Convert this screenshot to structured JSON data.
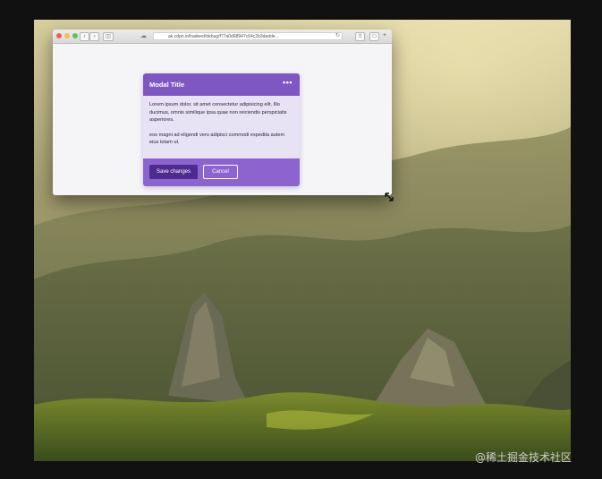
{
  "browser": {
    "address_text": "ak.cdpn.io/hadeed/debug/f77a0d68947c64c2b3dadde..."
  },
  "modal": {
    "title": "Modal Title",
    "menu_glyph": "•••",
    "body_paragraph_1": "Lorem ipsum dolor, sit amet consectetur adipisicing elit. Illo ducimus, omnis similique ipsa quae non reiciendis perspiciatis asperiores.",
    "body_paragraph_2": "eos magni ad eligendi vero adipisci commodi expedita autem eius totam ut.",
    "primary_button_label": "Save changes",
    "secondary_button_label": "Cancel"
  },
  "watermark": {
    "text": "@稀土掘金技术社区"
  },
  "colors": {
    "modal_header": "#7e57c2",
    "modal_body": "#e8e2f5",
    "modal_footer": "#8d63cf",
    "primary_button": "#4e2c8f"
  },
  "icons": {
    "window_controls": [
      "close-dot",
      "minimize-dot",
      "zoom-dot"
    ],
    "toolbar": [
      "back-icon",
      "forward-icon",
      "sidebar-icon",
      "cloud-icon",
      "reload-icon",
      "share-icon",
      "tabs-icon",
      "new-tab-icon"
    ],
    "pointer": "resize-cursor-icon"
  }
}
